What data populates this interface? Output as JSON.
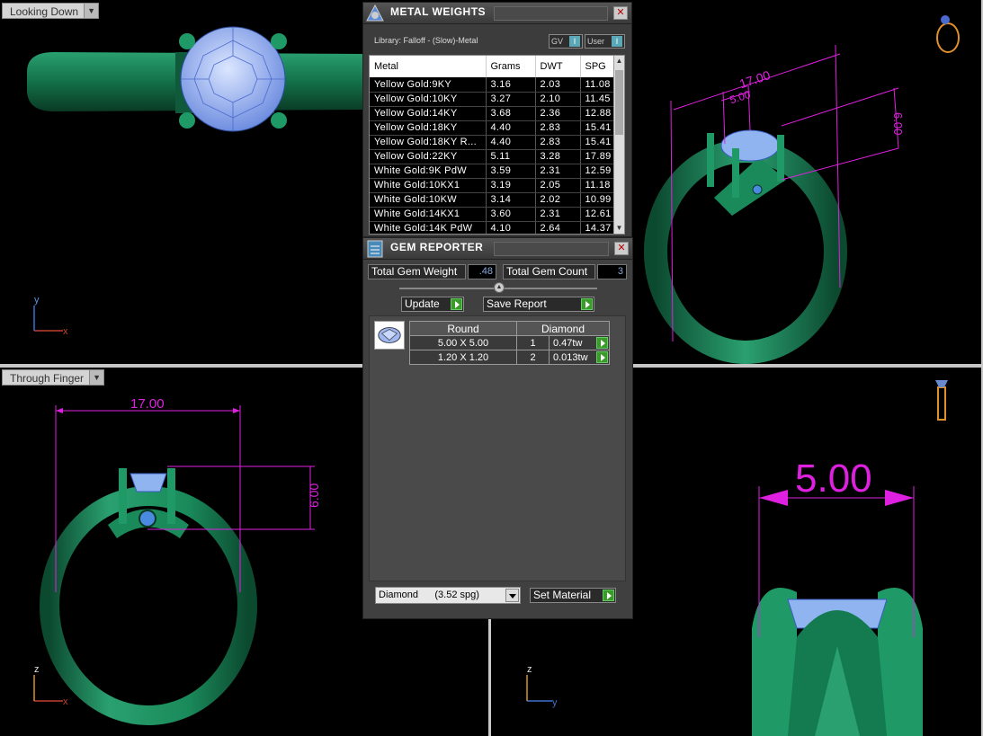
{
  "viewports": {
    "top_left": {
      "label": "Looking Down",
      "axes": {
        "v": "y",
        "h": "x"
      }
    },
    "top_right": {
      "label": "",
      "dims": {
        "width": "17.00",
        "stone": "5.00",
        "height": "6.00"
      }
    },
    "bottom_left": {
      "label": "Through Finger",
      "dims": {
        "width": "17.00",
        "height": "6.00"
      },
      "axes": {
        "v": "z",
        "h": "x"
      }
    },
    "bottom_right": {
      "label": "",
      "dims": {
        "stone": "5.00"
      },
      "axes": {
        "v": "z",
        "h": "y"
      }
    }
  },
  "metal_weights": {
    "title": "METAL WEIGHTS",
    "library": "Library: Falloff - (Slow)-Metal",
    "toggle_gv": "GV",
    "toggle_user": "User",
    "toggle_state": "I",
    "columns": [
      "Metal",
      "Grams",
      "DWT",
      "SPG"
    ],
    "rows": [
      [
        "Yellow Gold:9KY",
        "3.16",
        "2.03",
        "11.08"
      ],
      [
        "Yellow Gold:10KY",
        "3.27",
        "2.10",
        "11.45"
      ],
      [
        "Yellow Gold:14KY",
        "3.68",
        "2.36",
        "12.88"
      ],
      [
        "Yellow Gold:18KY",
        "4.40",
        "2.83",
        "15.41"
      ],
      [
        "Yellow Gold:18KY R...",
        "4.40",
        "2.83",
        "15.41"
      ],
      [
        "Yellow Gold:22KY",
        "5.11",
        "3.28",
        "17.89"
      ],
      [
        "White Gold:9K PdW",
        "3.59",
        "2.31",
        "12.59"
      ],
      [
        "White Gold:10KX1",
        "3.19",
        "2.05",
        "11.18"
      ],
      [
        "White Gold:10KW",
        "3.14",
        "2.02",
        "10.99"
      ],
      [
        "White Gold:14KX1",
        "3.60",
        "2.31",
        "12.61"
      ],
      [
        "White Gold:14K PdW",
        "4.10",
        "2.64",
        "14.37"
      ]
    ]
  },
  "gem_reporter": {
    "title": "GEM REPORTER",
    "total_weight_label": "Total Gem Weight",
    "total_weight_value": ".48",
    "total_count_label": "Total Gem Count",
    "total_count_value": "3",
    "update_label": "Update",
    "save_label": "Save Report",
    "shape_header": "Round",
    "material_header": "Diamond",
    "gems": [
      {
        "size": "5.00 X 5.00",
        "count": "1",
        "weight": "0.47tw"
      },
      {
        "size": "1.20 X 1.20",
        "count": "2",
        "weight": "0.013tw"
      }
    ],
    "material_select": "Diamond      (3.52 spg)",
    "set_material_label": "Set Material"
  },
  "colors": {
    "dimension": "#e020e0",
    "ring": "#1a8a5a",
    "gem": "#8fb4f0"
  }
}
